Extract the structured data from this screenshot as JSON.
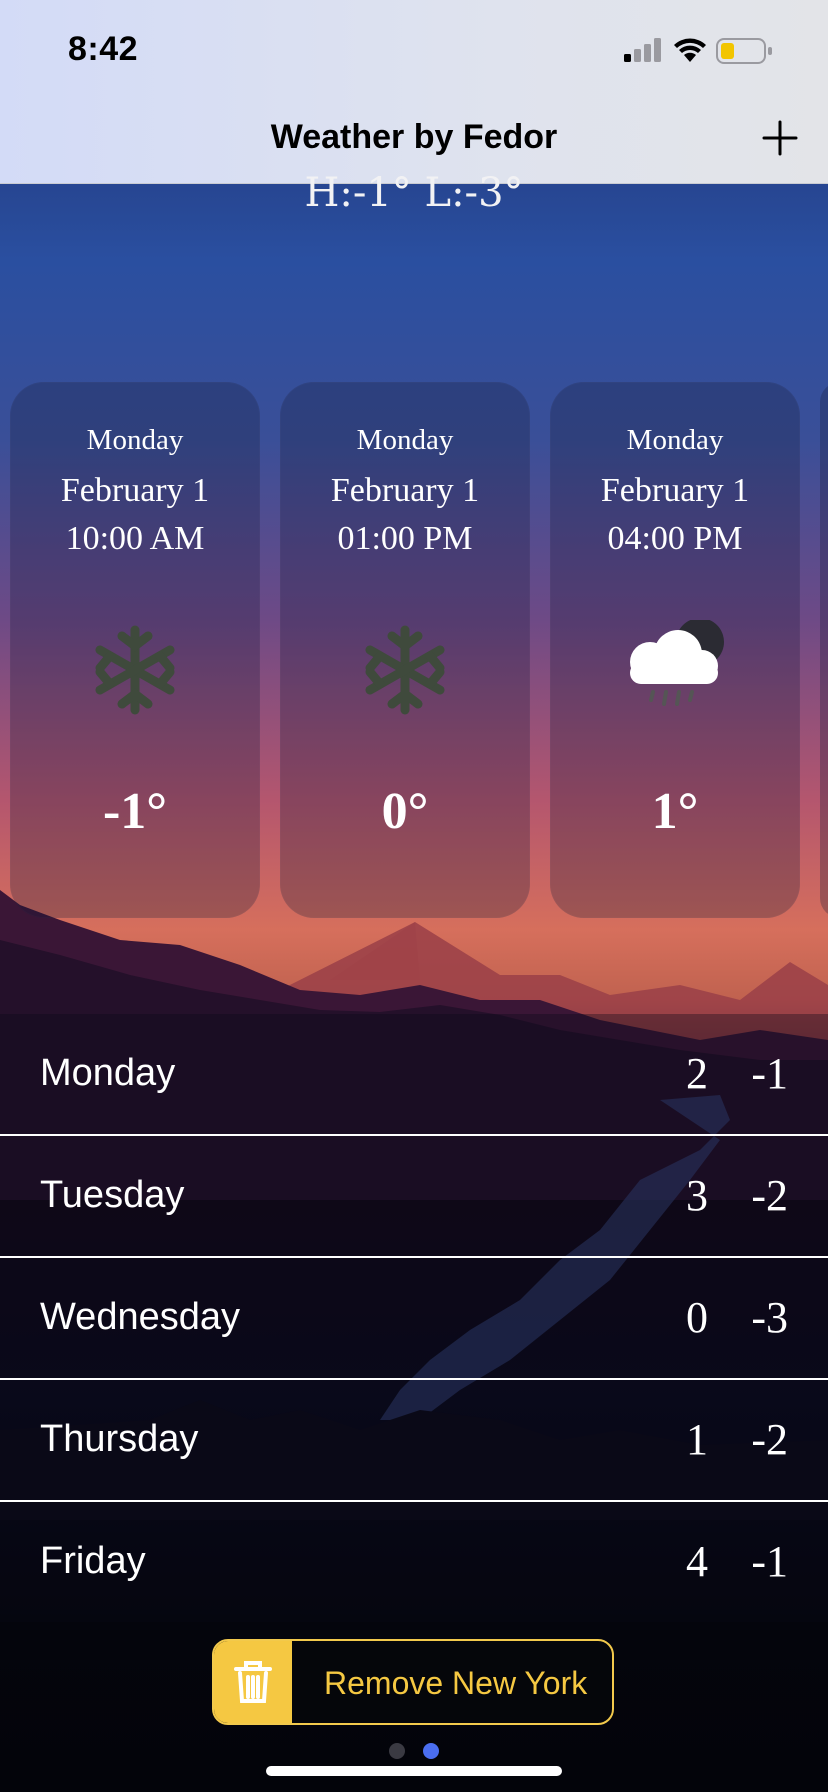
{
  "status_bar": {
    "time": "8:42",
    "icons": [
      "cellular-signal-icon",
      "wifi-icon",
      "battery-icon"
    ]
  },
  "nav": {
    "title": "Weather by Fedor",
    "add_icon": "plus-icon"
  },
  "today": {
    "high_low": "H:-1° L:-3°"
  },
  "hourly": [
    {
      "day": "Monday",
      "date": "February 1",
      "time": "10:00 AM",
      "icon": "snowflake-icon",
      "temp": "-1°"
    },
    {
      "day": "Monday",
      "date": "February 1",
      "time": "01:00 PM",
      "icon": "snowflake-icon",
      "temp": "0°"
    },
    {
      "day": "Monday",
      "date": "February 1",
      "time": "04:00 PM",
      "icon": "cloud-moon-rain-icon",
      "temp": "1°"
    }
  ],
  "daily": [
    {
      "day": "Monday",
      "high": "2",
      "low": "-1"
    },
    {
      "day": "Tuesday",
      "high": "3",
      "low": "-2"
    },
    {
      "day": "Wednesday",
      "high": "0",
      "low": "-3"
    },
    {
      "day": "Thursday",
      "high": "1",
      "low": "-2"
    },
    {
      "day": "Friday",
      "high": "4",
      "low": "-1"
    }
  ],
  "remove_button": {
    "label": "Remove New York",
    "icon": "trash-icon"
  },
  "pager": {
    "pages": 2,
    "current": 2
  },
  "colors": {
    "accent": "#f5c842",
    "page_active": "#4a6ef0",
    "page_inactive": "#3a3a42"
  }
}
